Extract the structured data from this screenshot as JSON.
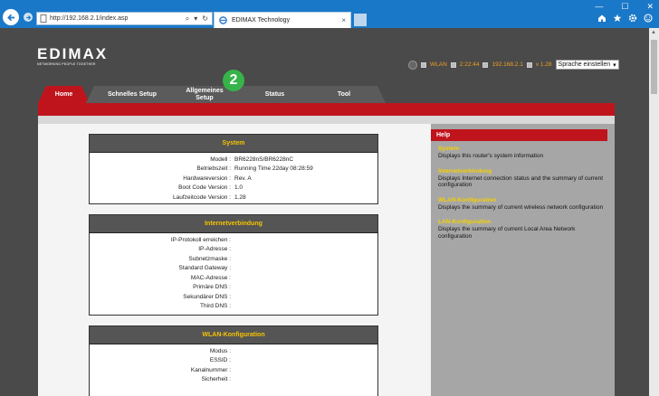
{
  "browser": {
    "url": "http://192.168.2.1/index.asp",
    "tab_title": "EDIMAX Technology",
    "tab_close": "×",
    "search_glyph": "⌕",
    "refresh_glyph": "↻",
    "window_controls": [
      "—",
      "☐",
      "✕"
    ],
    "tool_icons": [
      "home-icon",
      "star-icon",
      "gear-icon",
      "smiley-icon"
    ]
  },
  "router": {
    "logo": "EDIMAX",
    "tagline": "NETWORKING PEOPLE TOGETHER",
    "status": {
      "wlan_label": "WLAN",
      "uptime": "2:22:44",
      "ip": "192.168.2.1",
      "version": "v 1.28"
    },
    "language_select": "Sprache einstellen",
    "step_badge": "2",
    "tabs": [
      {
        "label": "Home",
        "active": true
      },
      {
        "label": "Schnelles Setup",
        "active": false
      },
      {
        "label": "Allgemeines Setup",
        "active": false
      },
      {
        "label": "Status",
        "active": false
      },
      {
        "label": "Tool",
        "active": false
      }
    ],
    "panels": {
      "system": {
        "title": "System",
        "rows": [
          {
            "key": "Modell :",
            "value": "BR6228nS/BR6228nC"
          },
          {
            "key": "Betriebszeit :",
            "value": "Running Time 22day 08:28:59"
          },
          {
            "key": "Hardwareversion :",
            "value": "Rev. A"
          },
          {
            "key": "Boot Code Version :",
            "value": "1.0"
          },
          {
            "key": "Laufzeitcode Version :",
            "value": "1.28"
          }
        ]
      },
      "internet": {
        "title": "Internetverbindung",
        "rows": [
          {
            "key": "IP-Protokoll erreichen :",
            "value": ""
          },
          {
            "key": "IP-Adresse :",
            "value": ""
          },
          {
            "key": "Subnetzmaske :",
            "value": ""
          },
          {
            "key": "Standard Gateway :",
            "value": ""
          },
          {
            "key": "MAC-Adresse :",
            "value": ""
          },
          {
            "key": "Primäre DNS :",
            "value": ""
          },
          {
            "key": "Sekundärer DNS :",
            "value": ""
          },
          {
            "key": "Third DNS :",
            "value": ""
          }
        ]
      },
      "wlan": {
        "title": "WLAN-Konfiguration",
        "rows": [
          {
            "key": "Modus :",
            "value": ""
          },
          {
            "key": "ESSID :",
            "value": ""
          },
          {
            "key": "Kanalnummer :",
            "value": ""
          },
          {
            "key": "Sicherheit :",
            "value": ""
          }
        ]
      }
    },
    "help": {
      "title": "Help",
      "items": [
        {
          "title": "System",
          "desc": "Displays this router's system information"
        },
        {
          "title": "Internetverbindung",
          "desc": "Displays Internet connection status and the summary of current configuration"
        },
        {
          "title": "WLAN-Konfiguration",
          "desc": "Displays the summary of current wireless network configuration"
        },
        {
          "title": "LAN-Konfiguration",
          "desc": "Displays the summary of current Local Area Network configuration"
        }
      ]
    }
  }
}
